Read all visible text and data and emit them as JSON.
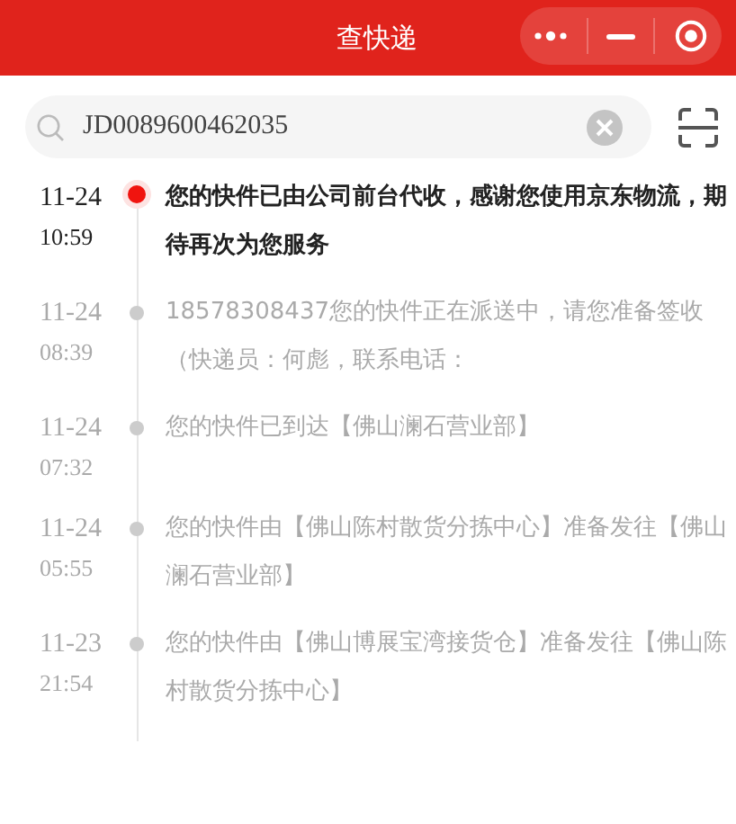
{
  "header": {
    "title": "查快递"
  },
  "search": {
    "value": "JD0089600462035"
  },
  "timeline": [
    {
      "date": "11-24",
      "time": "10:59",
      "text": "您的快件已由公司前台代收，感谢您使用京东物流，期待再次为您服务",
      "current": true
    },
    {
      "date": "11-24",
      "time": "08:39",
      "text": "18578308437您的快件正在派送中，请您准备签收（快递员：何彪，联系电话：",
      "current": false
    },
    {
      "date": "11-24",
      "time": "07:32",
      "text": "您的快件已到达【佛山澜石营业部】",
      "current": false
    },
    {
      "date": "11-24",
      "time": "05:55",
      "text": "您的快件由【佛山陈村散货分拣中心】准备发往【佛山澜石营业部】",
      "current": false
    },
    {
      "date": "11-23",
      "time": "21:54",
      "text": "您的快件由【佛山博展宝湾接货仓】准备发往【佛山陈村散货分拣中心】",
      "current": false
    }
  ]
}
